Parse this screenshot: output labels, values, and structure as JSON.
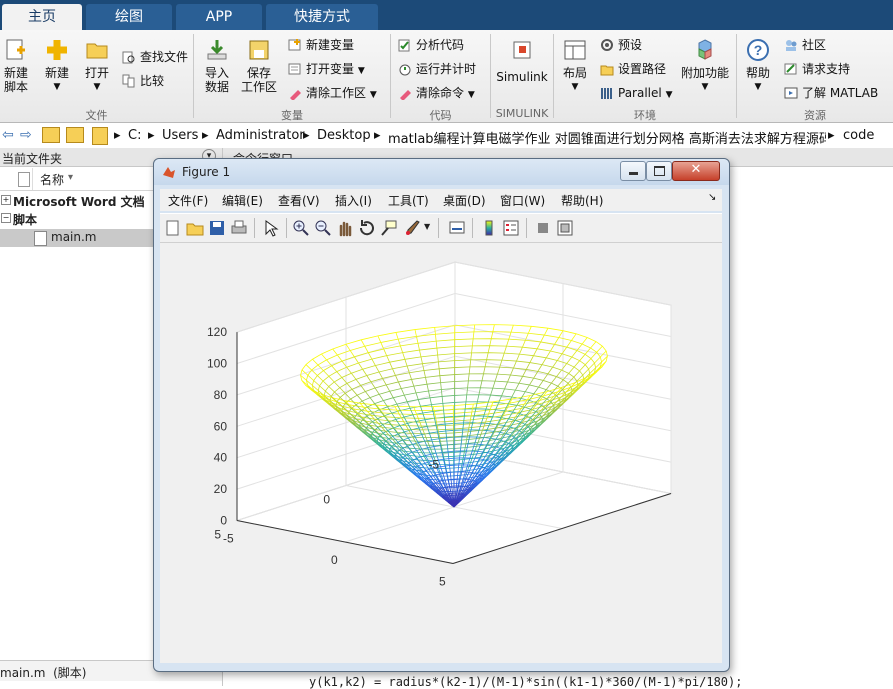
{
  "ribbon": {
    "tabs": [
      "主页",
      "绘图",
      "APP",
      "快捷方式"
    ],
    "active_tab": "主页",
    "big_buttons": {
      "new_script": "新建\n脚本",
      "new": "新建",
      "open": "打开",
      "import_data": "导入\n数据",
      "save_workspace": "保存\n工作区",
      "simulink": "Simulink",
      "layout": "布局",
      "addons": "附加功能",
      "help": "帮助"
    },
    "small_buttons": {
      "find_files": "查找文件",
      "compare": "比较",
      "new_variable": "新建变量",
      "open_variable": "打开变量",
      "clear_workspace": "清除工作区",
      "analyze_code": "分析代码",
      "run_and_time": "运行并计时",
      "clear_commands": "清除命令",
      "preferences": "预设",
      "set_path": "设置路径",
      "parallel": "Parallel",
      "community": "社区",
      "request_support": "请求支持",
      "learn_matlab": "了解 MATLAB"
    },
    "group_captions": [
      "文件",
      "变量",
      "代码",
      "SIMULINK",
      "环境",
      "资源"
    ]
  },
  "address": {
    "crumbs": [
      "C:",
      "Users",
      "Administrator",
      "Desktop",
      "matlab编程计算电磁学作业 对圆锥面进行划分网格 高斯消去法求解方程源码程序",
      "code"
    ]
  },
  "file_panel": {
    "title": "当前文件夹",
    "column_name": "名称",
    "sort_indicator": "▾",
    "groups": [
      {
        "label": "Microsoft Word 文档",
        "expander": "+"
      },
      {
        "label": "脚本",
        "expander": "−"
      }
    ],
    "files": [
      "main.m"
    ],
    "status": "main.m  (脚本)"
  },
  "command_window": {
    "title": "命令行窗口",
    "visible_line": "y(k1,k2) = radius*(k2-1)/(M-1)*sin((k1-1)*360/(M-1)*pi/180);"
  },
  "figure": {
    "title": "Figure 1",
    "menus": [
      "文件(F)",
      "编辑(E)",
      "查看(V)",
      "插入(I)",
      "工具(T)",
      "桌面(D)",
      "窗口(W)",
      "帮助(H)"
    ],
    "colors": {
      "top": "#f9fb0e",
      "mid": "#2ab0a0",
      "bottom": "#3e26a8"
    }
  },
  "chart_data": {
    "type": "surface",
    "shape": "cone",
    "title": "",
    "xlabel": "",
    "ylabel": "",
    "zlabel": "",
    "xlim": [
      -5,
      5
    ],
    "ylim": [
      -5,
      5
    ],
    "zlim": [
      0,
      120
    ],
    "z_ticks": [
      0,
      20,
      40,
      60,
      80,
      100,
      120
    ],
    "x_ticks": [
      -5,
      0,
      5
    ],
    "y_ticks": [
      -5,
      0,
      5
    ],
    "apex": [
      0,
      0,
      0
    ],
    "rim_radius": 5,
    "rim_height": 90,
    "colormap": "parula",
    "grid": true
  }
}
